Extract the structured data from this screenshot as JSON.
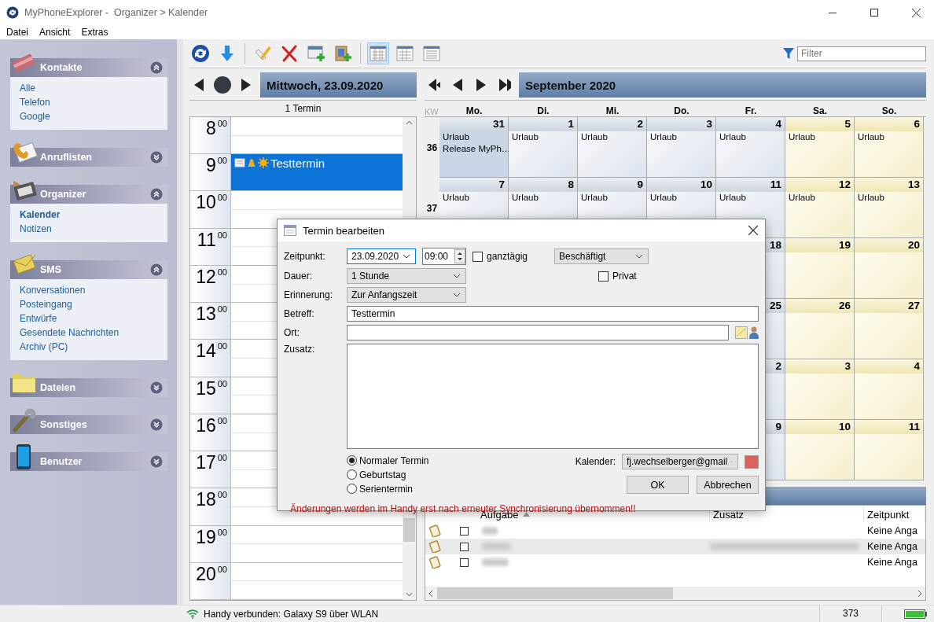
{
  "window": {
    "title": "MyPhoneExplorer -  Organizer > Kalender"
  },
  "menu": [
    "Datei",
    "Ansicht",
    "Extras"
  ],
  "sidebar": {
    "sections": [
      {
        "title": "Kontakte",
        "expanded": true,
        "items": [
          {
            "label": "Alle",
            "selected": false
          },
          {
            "label": "Telefon",
            "selected": false
          },
          {
            "label": "Google",
            "selected": false
          }
        ]
      },
      {
        "title": "Anruflisten",
        "expanded": false
      },
      {
        "title": "Organizer",
        "expanded": true,
        "items": [
          {
            "label": "Kalender",
            "selected": true
          },
          {
            "label": "Notizen",
            "selected": false
          }
        ]
      },
      {
        "title": "SMS",
        "expanded": true,
        "items": [
          {
            "label": "Konversationen",
            "selected": false
          },
          {
            "label": "Posteingang",
            "selected": false
          },
          {
            "label": "Entwürfe",
            "selected": false
          },
          {
            "label": "Gesendete Nachrichten",
            "selected": false
          },
          {
            "label": "Archiv (PC)",
            "selected": false
          }
        ]
      },
      {
        "title": "Dateien",
        "expanded": false
      },
      {
        "title": "Sonstiges",
        "expanded": false
      },
      {
        "title": "Benutzer",
        "expanded": false
      }
    ]
  },
  "toolbar": {
    "view_buttons": [
      {
        "selected": true
      },
      {
        "selected": false
      },
      {
        "selected": false
      }
    ],
    "filter": {
      "placeholder": "Filter"
    }
  },
  "day_view": {
    "title": "Mittwoch, 23.09.2020",
    "count": "1 Termin",
    "hours": [
      {
        "hour": "8",
        "minutes": "00"
      },
      {
        "hour": "9",
        "minutes": "00",
        "event": {
          "title": "Testtermin",
          "selected": true
        }
      },
      {
        "hour": "10",
        "minutes": "00"
      },
      {
        "hour": "11",
        "minutes": "00"
      },
      {
        "hour": "12",
        "minutes": "00"
      },
      {
        "hour": "13",
        "minutes": "00"
      },
      {
        "hour": "14",
        "minutes": "00"
      },
      {
        "hour": "15",
        "minutes": "00"
      },
      {
        "hour": "16",
        "minutes": "00"
      },
      {
        "hour": "17",
        "minutes": "00"
      },
      {
        "hour": "18",
        "minutes": "00"
      },
      {
        "hour": "19",
        "minutes": "00"
      },
      {
        "hour": "20",
        "minutes": "00"
      }
    ]
  },
  "month_view": {
    "title": "September 2020",
    "kw_label": "KW",
    "weekdays": [
      "Mo.",
      "Di.",
      "Mi.",
      "Do.",
      "Fr.",
      "Sa.",
      "So."
    ],
    "weeks": [
      {
        "kw": "36",
        "days": [
          {
            "day": "31",
            "selected": true,
            "entries": [
              "Urlaub",
              "Release MyPh…"
            ]
          },
          {
            "day": "1",
            "selected": false,
            "entries": [
              "Urlaub"
            ]
          },
          {
            "day": "2",
            "selected": false,
            "entries": [
              "Urlaub"
            ]
          },
          {
            "day": "3",
            "selected": false,
            "entries": [
              "Urlaub"
            ]
          },
          {
            "day": "4",
            "selected": false,
            "entries": [
              "Urlaub"
            ]
          },
          {
            "day": "5",
            "selected": false,
            "entries": [
              "Urlaub"
            ]
          },
          {
            "day": "6",
            "selected": false,
            "entries": [
              "Urlaub"
            ]
          }
        ]
      },
      {
        "kw": "37",
        "days": [
          {
            "day": "7",
            "selected": false,
            "entries": [
              "Urlaub"
            ]
          },
          {
            "day": "8",
            "selected": false,
            "entries": [
              "Urlaub"
            ]
          },
          {
            "day": "9",
            "selected": false,
            "entries": [
              "Urlaub"
            ]
          },
          {
            "day": "10",
            "selected": false,
            "entries": [
              "Urlaub"
            ]
          },
          {
            "day": "11",
            "selected": false,
            "entries": [
              "Urlaub"
            ]
          },
          {
            "day": "12",
            "selected": false,
            "entries": [
              "Urlaub"
            ]
          },
          {
            "day": "13",
            "selected": false,
            "entries": [
              "Urlaub"
            ]
          }
        ]
      },
      {
        "days": [
          {
            "day": "18",
            "selected": false
          },
          {
            "day": "19",
            "selected": false
          },
          {
            "day": "20",
            "selected": false
          }
        ]
      },
      {
        "days": [
          {
            "day": "25",
            "selected": false
          },
          {
            "day": "26",
            "selected": false
          },
          {
            "day": "27",
            "selected": false
          }
        ]
      },
      {
        "days": [
          {
            "day": "2",
            "selected": false
          },
          {
            "day": "3",
            "selected": false
          },
          {
            "day": "4",
            "selected": false
          }
        ]
      },
      {
        "days": [
          {
            "day": "9",
            "selected": false
          },
          {
            "day": "10",
            "selected": false
          },
          {
            "day": "11",
            "selected": false
          }
        ]
      }
    ]
  },
  "tasks": {
    "columns": [
      {
        "label": "Aufgabe",
        "sorted": true
      },
      {
        "label": "Zusatz",
        "sorted": false
      },
      {
        "label": "Zeitpunkt",
        "sorted": false
      }
    ],
    "rows": [
      {
        "done": false,
        "selected": false,
        "zeitpunkt": "Keine Anga"
      },
      {
        "done": false,
        "selected": true,
        "zeitpunkt": "Keine Anga"
      },
      {
        "done": false,
        "selected": false,
        "zeitpunkt": "Keine Anga"
      }
    ]
  },
  "status_bar": {
    "connection": "Handy verbunden: Galaxy S9 über WLAN",
    "count": "373"
  },
  "dialog": {
    "title": "Termin bearbeiten",
    "zeitpunkt": {
      "label": "Zeitpunkt:",
      "date": "23.09.2020",
      "time": "09:00"
    },
    "ganztaegig": {
      "label": "ganztägig",
      "checked": false
    },
    "status": {
      "value": "Beschäftigt"
    },
    "dauer": {
      "label": "Dauer:",
      "value": "1 Stunde"
    },
    "privat": {
      "label": "Privat",
      "checked": false
    },
    "erinnerung": {
      "label": "Erinnerung:",
      "value": "Zur Anfangszeit"
    },
    "betreff": {
      "label": "Betreff:",
      "value": "Testtermin"
    },
    "ort": {
      "label": "Ort:"
    },
    "zusatz": {
      "label": "Zusatz:"
    },
    "types": [
      {
        "label": "Normaler Termin",
        "selected": true
      },
      {
        "label": "Geburtstag",
        "selected": false
      },
      {
        "label": "Serientermin",
        "selected": false
      }
    ],
    "kalender": {
      "label": "Kalender:",
      "value": "fj.wechselberger@gmail",
      "color": "#d8625c"
    },
    "buttons": [
      "OK",
      "Abbrechen"
    ],
    "warning": "Änderungen werden im Handy erst nach erneuter Synchronisierung übernommen!!"
  }
}
